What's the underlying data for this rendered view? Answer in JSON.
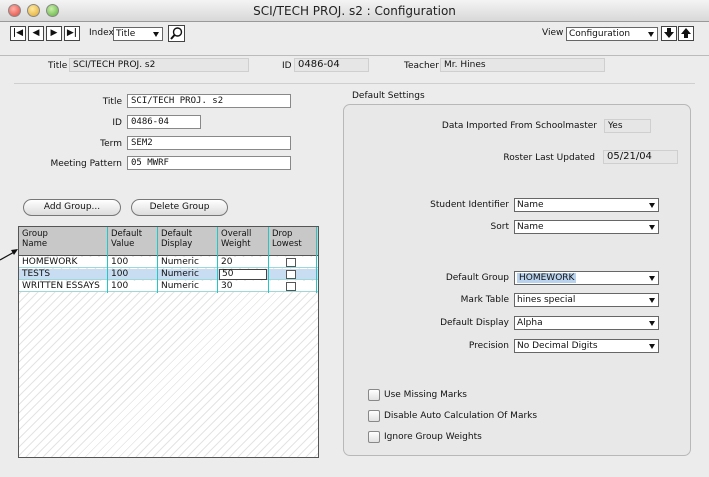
{
  "window": {
    "title": "SCI/TECH PROJ. s2 : Configuration"
  },
  "toolbar": {
    "nav_buttons": [
      "|◀",
      "◀",
      "▶",
      "▶|"
    ],
    "index_label": "Index",
    "index_value": "Title",
    "view_label": "View",
    "view_value": "Configuration"
  },
  "info_bar": {
    "title_label": "Title",
    "title_value": "SCI/TECH PROJ. s2",
    "id_label": "ID",
    "id_value": "0486-04",
    "teacher_label": "Teacher",
    "teacher_value": "Mr. Hines"
  },
  "form": {
    "title_label": "Title",
    "title_value": "SCI/TECH PROJ. s2",
    "id_label": "ID",
    "id_value": "0486-04",
    "term_label": "Term",
    "term_value": "SEM2",
    "pattern_label": "Meeting Pattern",
    "pattern_value": "05 MWRF"
  },
  "buttons": {
    "add_group": "Add Group...",
    "delete_group": "Delete Group"
  },
  "grid": {
    "headers": [
      [
        "Group",
        "Name"
      ],
      [
        "Default",
        "Value"
      ],
      [
        "Default",
        "Display"
      ],
      [
        "Overall",
        "Weight"
      ],
      [
        "Drop",
        "Lowest"
      ]
    ],
    "rows": [
      {
        "name": "HOMEWORK",
        "value": "100",
        "display": "Numeric",
        "weight": "20",
        "drop": false
      },
      {
        "name": "TESTS",
        "value": "100",
        "display": "Numeric",
        "weight": "50",
        "drop": false
      },
      {
        "name": "WRITTEN ESSAYS",
        "value": "100",
        "display": "Numeric",
        "weight": "30",
        "drop": false
      }
    ]
  },
  "settings": {
    "legend": "Default Settings",
    "imported_label": "Data Imported From Schoolmaster",
    "imported_value": "Yes",
    "roster_label": "Roster Last Updated",
    "roster_value": "05/21/04",
    "student_id_label": "Student Identifier",
    "student_id_value": "Name",
    "sort_label": "Sort",
    "sort_value": "Name",
    "default_group_label": "Default Group",
    "default_group_value": "HOMEWORK",
    "mark_table_label": "Mark Table",
    "mark_table_value": "hines special",
    "default_display_label": "Default Display",
    "default_display_value": "Alpha",
    "precision_label": "Precision",
    "precision_value": "No Decimal Digits",
    "checkboxes": [
      "Use Missing Marks",
      "Disable Auto Calculation Of Marks",
      "Ignore Group Weights"
    ]
  },
  "colors": {
    "accent_cyan": "#26c6c6",
    "selection": "#c9ddf2"
  }
}
